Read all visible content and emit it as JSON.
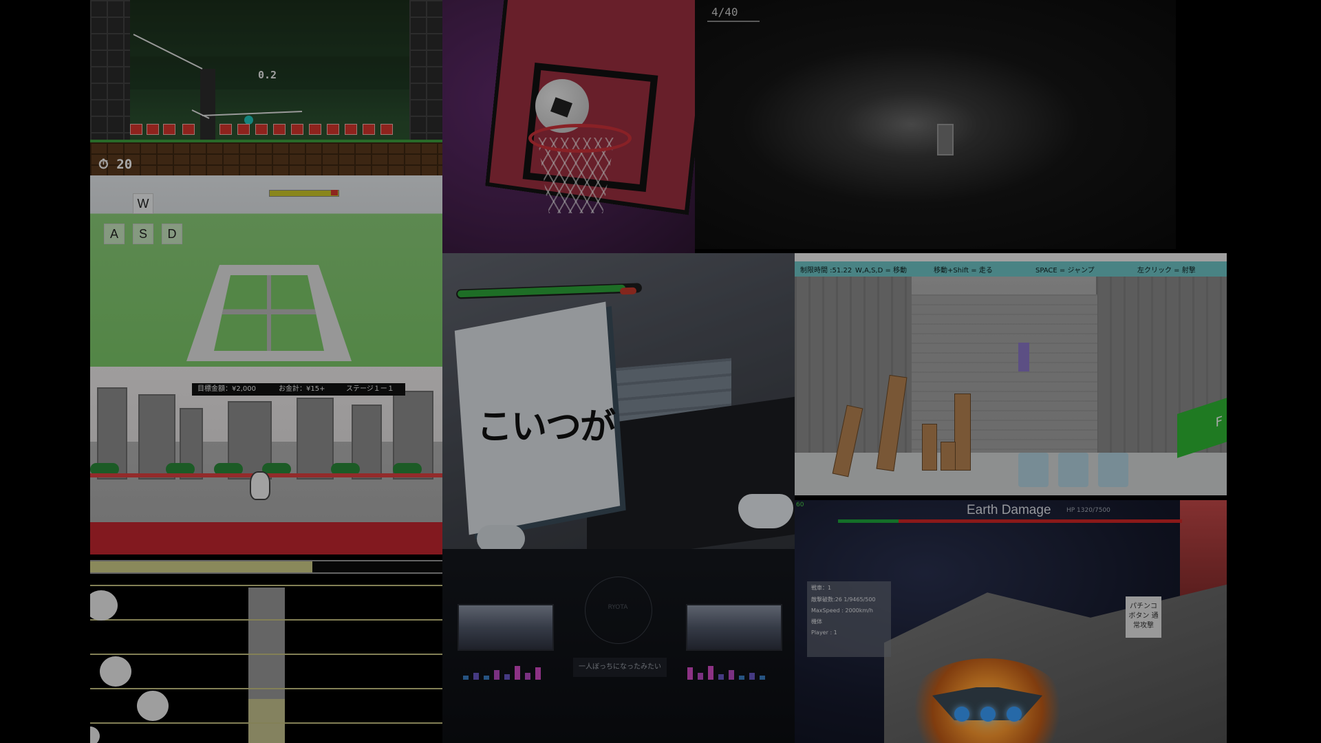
{
  "platformer": {
    "score": "0.2",
    "timer": "20",
    "timer_icon": "stopwatch-icon"
  },
  "basketball": {},
  "dark_room": {
    "counter": "4/40"
  },
  "maze": {
    "keys": [
      "W",
      "A",
      "S",
      "D"
    ],
    "health_fraction": 0.9
  },
  "city_runner": {
    "hud": {
      "target": "目標金額：¥2,000",
      "money": "お金計：¥15+",
      "stage": "ステージ１ー１"
    }
  },
  "rhythm": {
    "progress_fraction": 0.63
  },
  "vr_room": {
    "sign_text": "こいつが",
    "health_fraction": 0.92
  },
  "fps": {
    "time": "制限時間 :51.22",
    "controls": [
      "W,A,S,D = 移動",
      "移動+Shift = 走る",
      "SPACE = ジャンプ",
      "左クリック = 射撃"
    ],
    "green_key": "F"
  },
  "menu": {
    "circle_label": "RYOTA",
    "caption": "一人ぼっちになったみたい"
  },
  "space": {
    "title": "Earth Damage",
    "hp": "HP 1320/7500",
    "fps": "60",
    "health_fraction": 0.176,
    "stats": [
      "戦車：1",
      "敵撃破数:26 1/9465/500",
      "MaxSpeed : 2000km/h",
      "機体",
      "Player : 1"
    ],
    "button": "パチンコ ボタン 通常攻撃"
  },
  "colors": {
    "cyan": "#20c8c0",
    "tip_bar": "#6fc7c8",
    "hp_green": "#2ea83a",
    "hp_red": "#d32626"
  }
}
